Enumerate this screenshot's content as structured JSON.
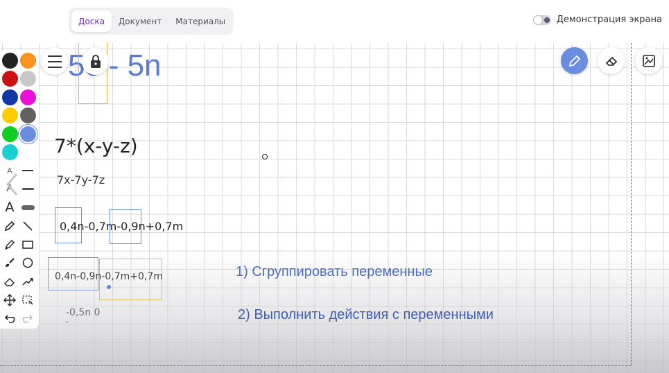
{
  "tabs": [
    {
      "label": "Доска",
      "active": true
    },
    {
      "label": "Документ",
      "active": false
    },
    {
      "label": "Материалы",
      "active": false
    }
  ],
  "screen_share": {
    "label": "Демонстрация экрана",
    "enabled": false
  },
  "board": {
    "top_formula": "5c - 5n",
    "expr_main": "7*(x-y-z)",
    "expr_expanded": "7x-7y-7z",
    "expr_line1": "0,4n-0,7m-0,9n+0,7m",
    "expr_line2": "0,4n-0,9n-0,7m+0,7m",
    "expr_result": "-0,5n 0",
    "step1": "1) Сгруппировать переменные",
    "step2": "2) Выполнить действия с переменными"
  },
  "palette_colors": [
    "#222222",
    "#f7931e",
    "#cc1111",
    "#c8c8c8",
    "#1136a8",
    "#e811d8",
    "#ffcc00",
    "#616161",
    "#11cc22",
    "#6a8de0",
    "#17cfcf"
  ],
  "selected_color": "#6a8de0",
  "tools": {
    "text_small": "A",
    "text_medium": "A",
    "text_large": "A"
  },
  "icons": [
    "menu-icon",
    "lock-icon",
    "pencil-icon",
    "eraser-icon",
    "image-icon",
    "undo-icon",
    "redo-icon",
    "move-icon",
    "select-icon"
  ]
}
